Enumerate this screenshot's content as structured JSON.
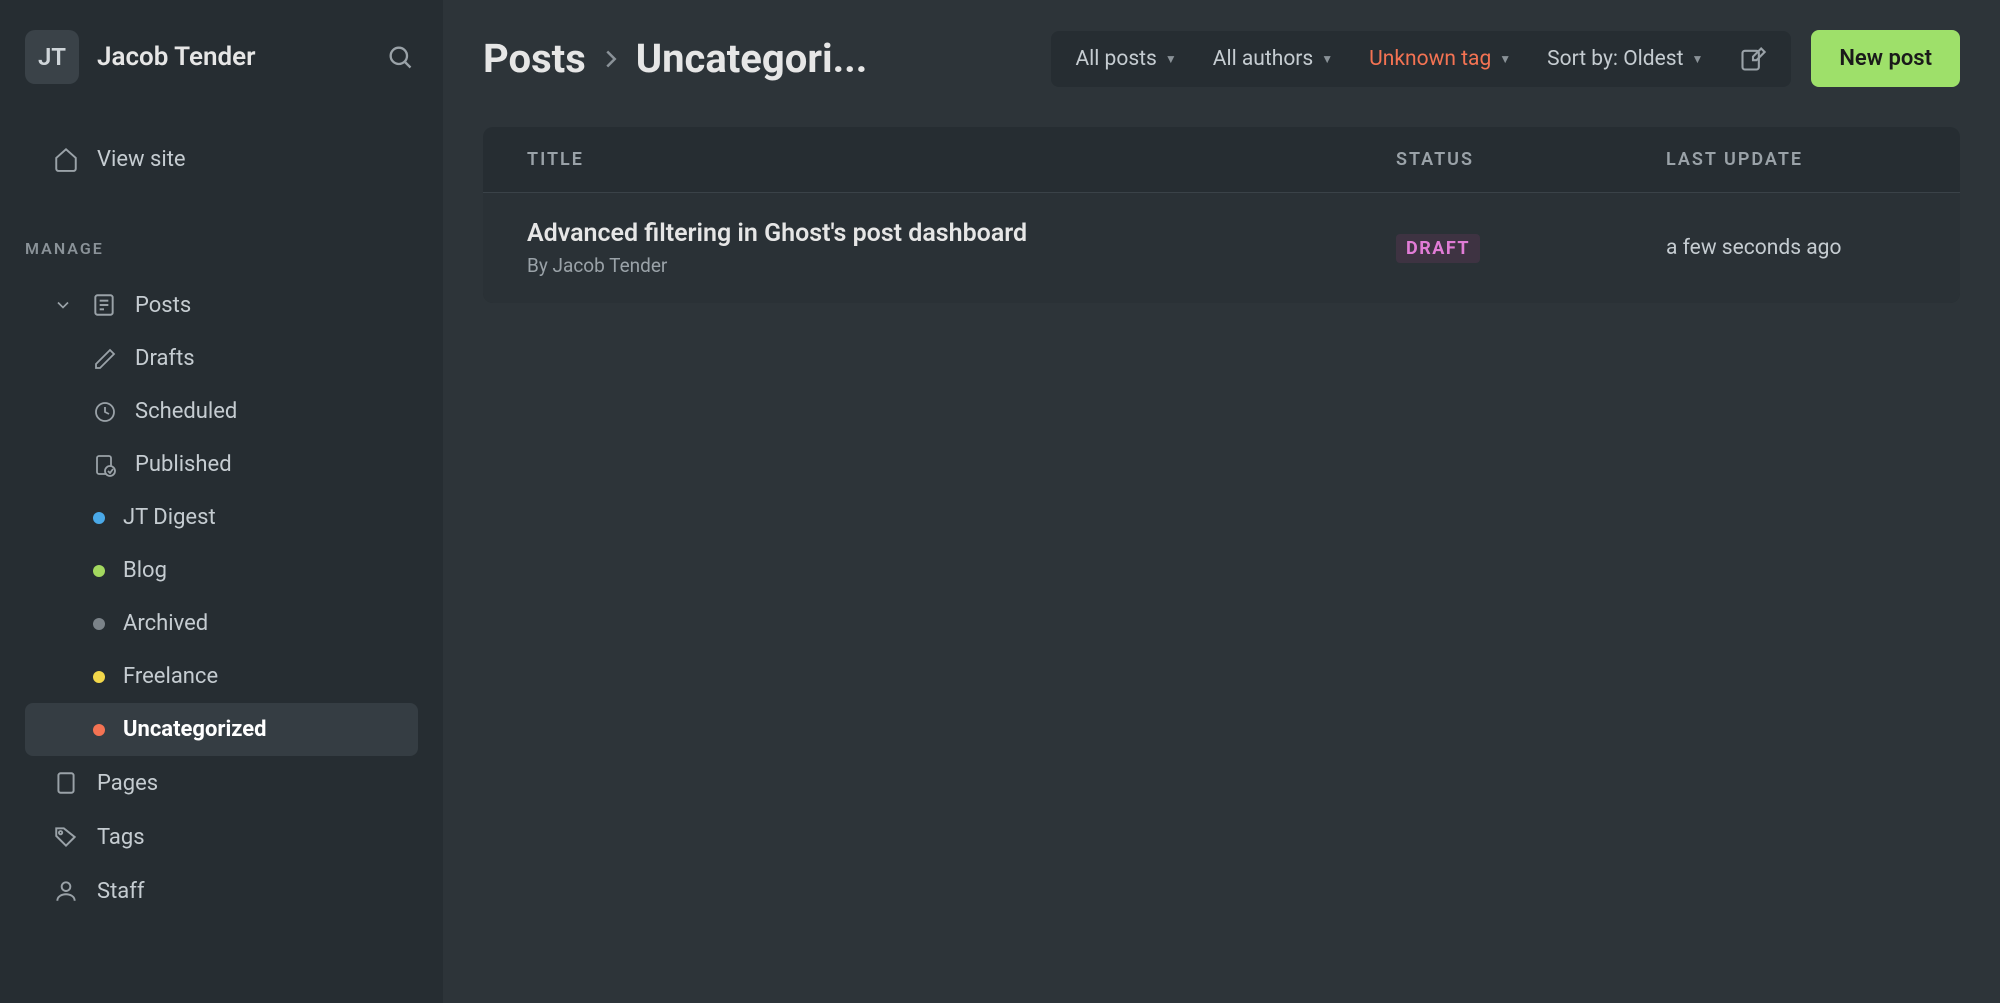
{
  "sidebar": {
    "avatar_initials": "JT",
    "site_name": "Jacob Tender",
    "view_site": "View site",
    "section_label": "MANAGE",
    "posts_label": "Posts",
    "sub_items": [
      {
        "label": "Drafts",
        "icon": "pencil"
      },
      {
        "label": "Scheduled",
        "icon": "clock"
      },
      {
        "label": "Published",
        "icon": "doc-check"
      },
      {
        "label": "JT Digest",
        "dot": "#4aa9e8"
      },
      {
        "label": "Blog",
        "dot": "#a3d85f"
      },
      {
        "label": "Archived",
        "dot": "#7b8389"
      },
      {
        "label": "Freelance",
        "dot": "#f2d74a"
      },
      {
        "label": "Uncategorized",
        "dot": "#f47353",
        "active": true
      }
    ],
    "pages_label": "Pages",
    "tags_label": "Tags",
    "staff_label": "Staff"
  },
  "header": {
    "breadcrumb_root": "Posts",
    "breadcrumb_current": "Uncategori...",
    "filters": {
      "posts": "All posts",
      "authors": "All authors",
      "tag": "Unknown tag",
      "sort": "Sort by: Oldest"
    },
    "new_post": "New post"
  },
  "table": {
    "headers": {
      "title": "TITLE",
      "status": "STATUS",
      "update": "LAST UPDATE"
    },
    "rows": [
      {
        "title": "Advanced filtering in Ghost's post dashboard",
        "author": "By Jacob Tender",
        "status": "DRAFT",
        "update": "a few seconds ago"
      }
    ]
  }
}
